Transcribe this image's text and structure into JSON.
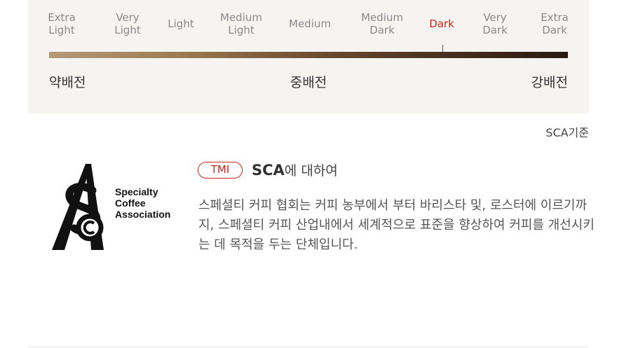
{
  "roast_scale": {
    "levels": [
      {
        "label": "Extra\nLight",
        "active": false
      },
      {
        "label": "Very\nLight",
        "active": false
      },
      {
        "label": "Light",
        "active": false
      },
      {
        "label": "Medium\nLight",
        "active": false
      },
      {
        "label": "Medium",
        "active": false
      },
      {
        "label": "Medium\nDark",
        "active": false
      },
      {
        "label": "Dark",
        "active": true
      },
      {
        "label": "Very\nDark",
        "active": false
      },
      {
        "label": "Extra\nDark",
        "active": false
      }
    ],
    "selected_level": "Dark",
    "active_color": "#c8281e",
    "bar_gradient": [
      "#b49a78",
      "#2a1a12"
    ],
    "bottom_labels": {
      "light": "약배전",
      "medium": "중배전",
      "dark": "강배전"
    }
  },
  "standard_note": "SCA기준",
  "logo": {
    "icon": "sca-logo-icon",
    "text_lines": [
      "Specialty",
      "Coffee",
      "Association"
    ]
  },
  "about": {
    "badge": "TMI",
    "title_strong": "SCA",
    "title_rest": "에 대하여",
    "body": "스페셜티 커피 협회는 커피 농부에서 부터 바리스타 및, 로스터에 이르기까지, 스페셜티 커피 산업내에서 세계적으로 표준을 향상하여 커피를 개선시키는 데 목적을 두는 단체입니다."
  }
}
